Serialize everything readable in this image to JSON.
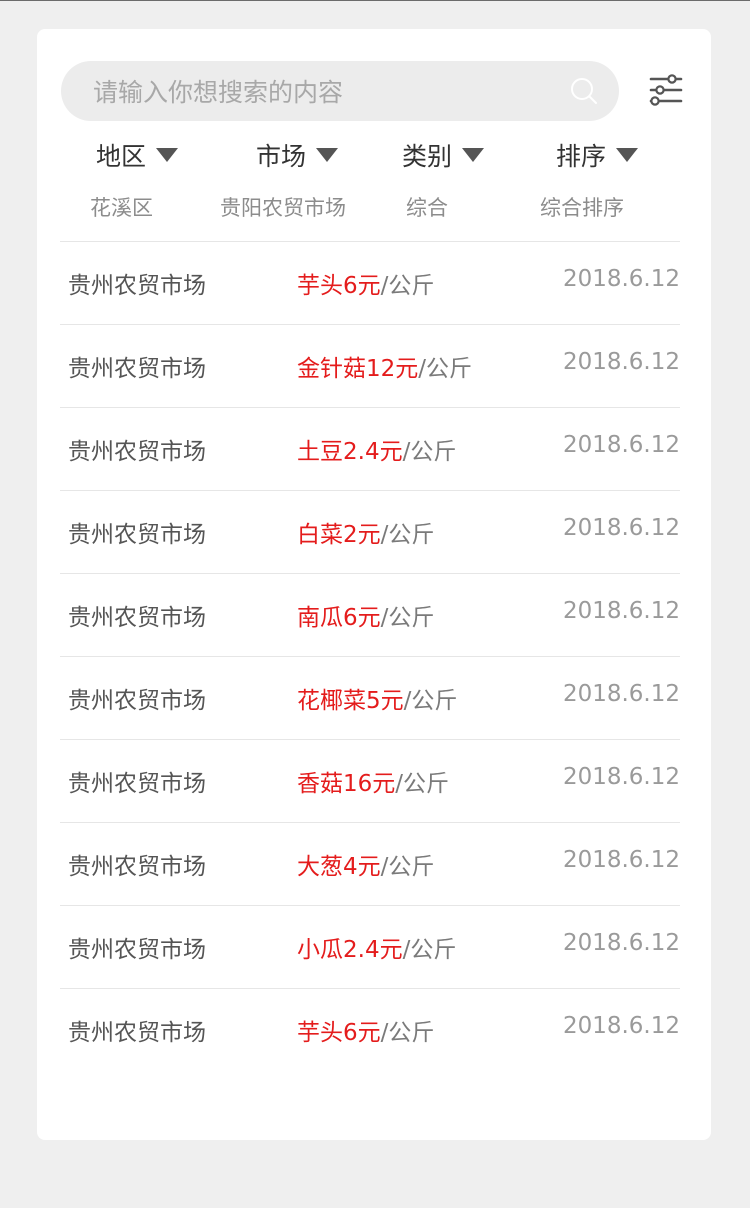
{
  "search": {
    "placeholder": "请输入你想搜索的内容"
  },
  "filters": [
    {
      "label": "地区",
      "value": "花溪区"
    },
    {
      "label": "市场",
      "value": "贵阳农贸市场"
    },
    {
      "label": "类别",
      "value": "综合"
    },
    {
      "label": "排序",
      "value": "综合排序"
    }
  ],
  "rows": [
    {
      "market": "贵州农贸市场",
      "price": "芋头6元",
      "unit": "/公斤",
      "date": "2018.6.12"
    },
    {
      "market": "贵州农贸市场",
      "price": "金针菇12元",
      "unit": "/公斤",
      "date": "2018.6.12"
    },
    {
      "market": "贵州农贸市场",
      "price": "土豆2.4元",
      "unit": "/公斤",
      "date": "2018.6.12"
    },
    {
      "market": "贵州农贸市场",
      "price": "白菜2元",
      "unit": "/公斤",
      "date": "2018.6.12"
    },
    {
      "market": "贵州农贸市场",
      "price": "南瓜6元",
      "unit": "/公斤",
      "date": "2018.6.12"
    },
    {
      "market": "贵州农贸市场",
      "price": "花椰菜5元",
      "unit": "/公斤",
      "date": "2018.6.12"
    },
    {
      "market": "贵州农贸市场",
      "price": "香菇16元",
      "unit": "/公斤",
      "date": "2018.6.12"
    },
    {
      "market": "贵州农贸市场",
      "price": "大葱4元",
      "unit": "/公斤",
      "date": "2018.6.12"
    },
    {
      "market": "贵州农贸市场",
      "price": "小瓜2.4元",
      "unit": "/公斤",
      "date": "2018.6.12"
    },
    {
      "market": "贵州农贸市场",
      "price": "芋头6元",
      "unit": "/公斤",
      "date": "2018.6.12"
    }
  ],
  "colors": {
    "price": "#e41c1c",
    "background": "#efefef",
    "card": "#ffffff"
  },
  "icons": {
    "search": "search-icon",
    "filter": "filter-settings-icon",
    "dropdown": "triangle-down-icon"
  }
}
